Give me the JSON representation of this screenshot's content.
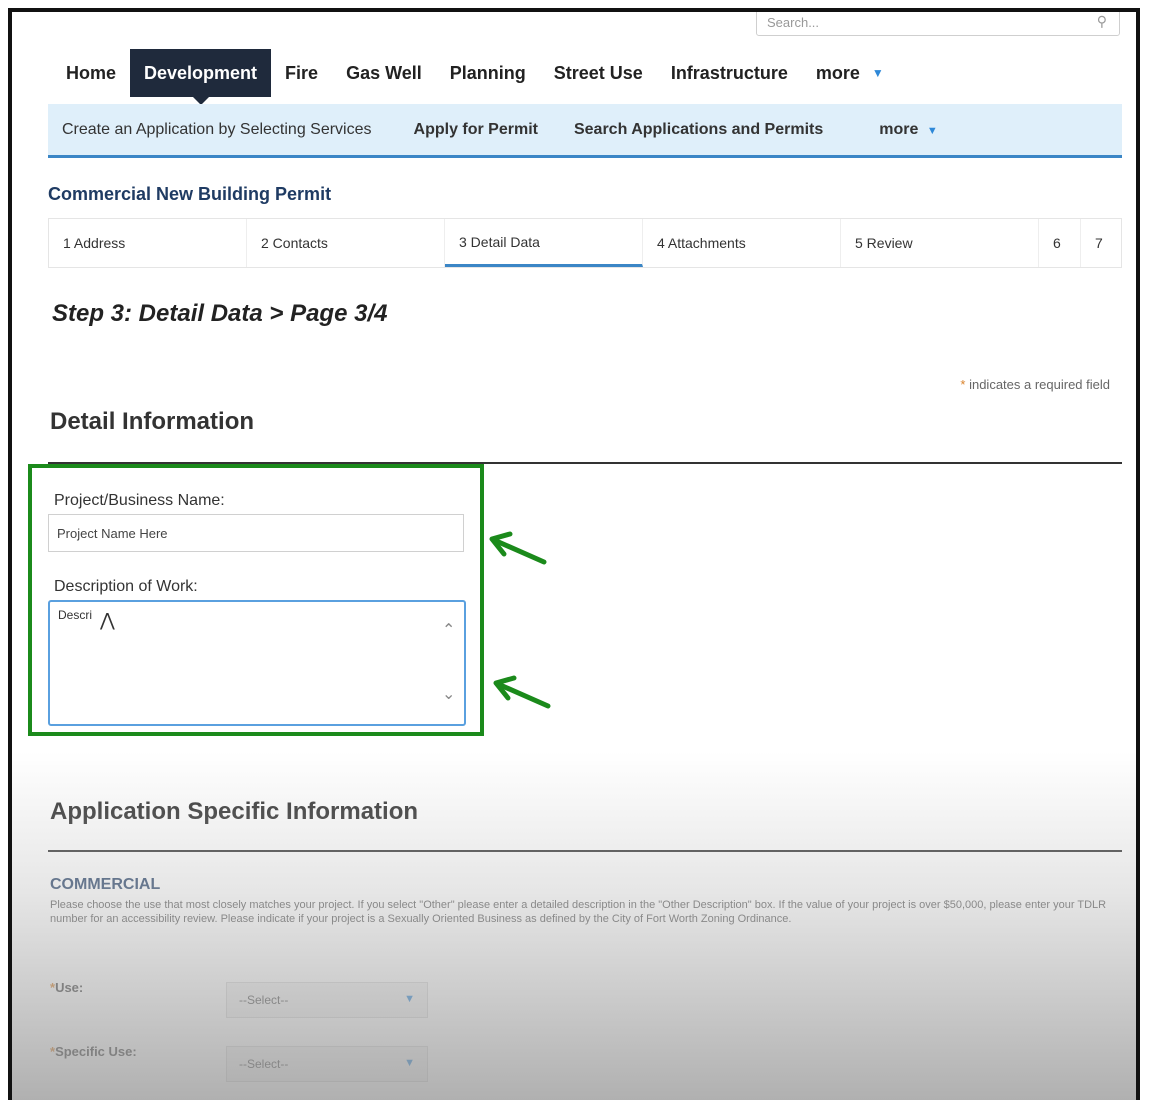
{
  "search": {
    "placeholder": "Search...",
    "icon": "search-icon"
  },
  "top_nav": {
    "tabs": [
      {
        "label": "Home",
        "active": false
      },
      {
        "label": "Development",
        "active": true
      },
      {
        "label": "Fire",
        "active": false
      },
      {
        "label": "Gas Well",
        "active": false
      },
      {
        "label": "Planning",
        "active": false
      },
      {
        "label": "Street Use",
        "active": false
      },
      {
        "label": "Infrastructure",
        "active": false
      },
      {
        "label": "more",
        "active": false
      }
    ]
  },
  "sub_nav": {
    "items": [
      {
        "label": "Create an Application by Selecting Services"
      },
      {
        "label": "Apply for Permit"
      },
      {
        "label": "Search Applications and Permits"
      },
      {
        "label": "more"
      }
    ]
  },
  "permit_title": "Commercial New Building Permit",
  "steps": [
    {
      "label": "1  Address"
    },
    {
      "label": "2  Contacts"
    },
    {
      "label": "3  Detail Data",
      "active": true
    },
    {
      "label": "4  Attachments"
    },
    {
      "label": "5  Review"
    },
    {
      "label": "6"
    },
    {
      "label": "7"
    }
  ],
  "step_heading": "Step 3: Detail Data > Page 3/4",
  "required_note": {
    "star": "*",
    "text": " indicates a required field"
  },
  "detail_section": {
    "title": "Detail Information",
    "project_label": "Project/Business Name:",
    "project_value": "Project Name Here",
    "description_label": "Description of Work:",
    "description_value": "Descri"
  },
  "app_section": {
    "title": "Application Specific Information",
    "commercial_title": "COMMERCIAL",
    "commercial_desc": "Please choose the use that most closely matches your project. If you select \"Other\" please enter a detailed description in the \"Other Description\" box. If the value of your project is over $50,000, please enter your TDLR number for an accessibility review. Please indicate if your project is a Sexually Oriented Business as defined by the City of Fort Worth Zoning Ordinance.",
    "use_label": "Use:",
    "use_value": "--Select--",
    "specific_use_label": "Specific Use:",
    "specific_use_value": "--Select--"
  },
  "colors": {
    "nav_active": "#1f2a3c",
    "subnav_bg": "#dfeffa",
    "accent_blue": "#3b86c6",
    "highlight_green": "#1b8a1b",
    "required_star": "#d9822b"
  }
}
